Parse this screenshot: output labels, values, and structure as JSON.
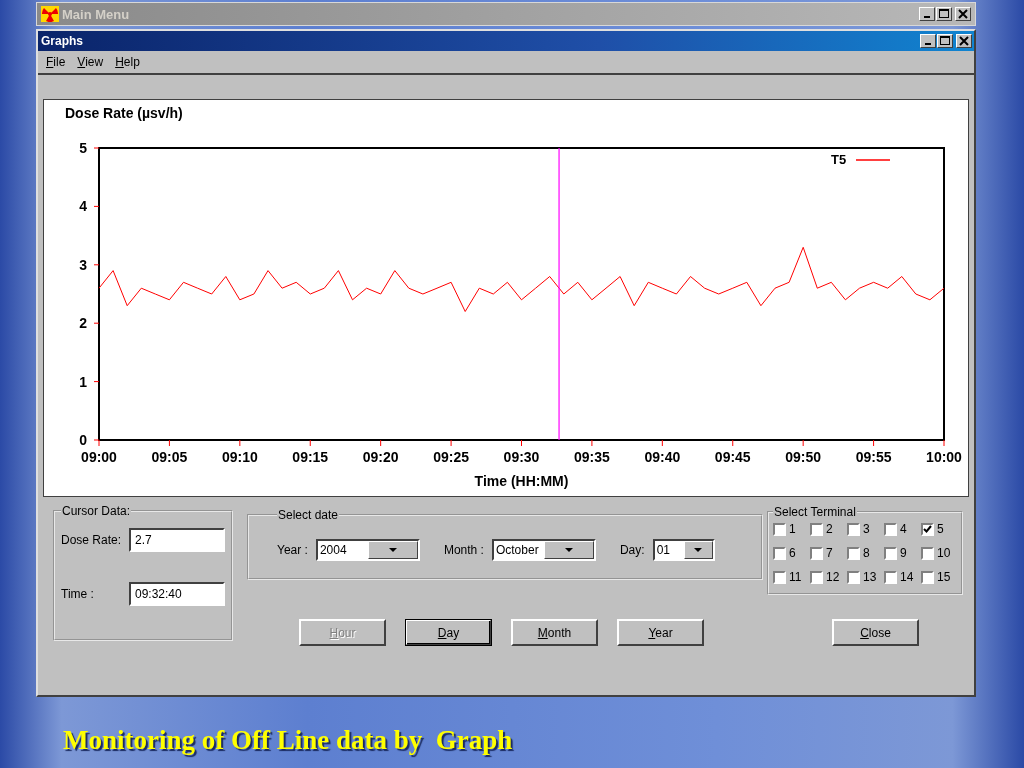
{
  "background_window": {
    "title": "Main Menu"
  },
  "window": {
    "title": "Graphs"
  },
  "menu": [
    "File",
    "View",
    "Help"
  ],
  "chart": {
    "chart_data": {
      "type": "line",
      "title": "Dose Rate (µsv/h)",
      "xlabel": "Time (HH:MM)",
      "ylim": [
        0,
        5
      ],
      "categories": [
        "09:00",
        null,
        null,
        null,
        null,
        "09:05",
        null,
        null,
        null,
        null,
        "09:10",
        null,
        null,
        null,
        null,
        "09:15",
        null,
        null,
        null,
        null,
        "09:20",
        null,
        null,
        null,
        null,
        "09:25",
        null,
        null,
        null,
        null,
        "09:30",
        null,
        null,
        null,
        null,
        "09:35",
        null,
        null,
        null,
        null,
        "09:40",
        null,
        null,
        null,
        null,
        "09:45",
        null,
        null,
        null,
        null,
        "09:50",
        null,
        null,
        null,
        null,
        "09:55",
        null,
        null,
        null,
        null,
        "10:00"
      ],
      "yticks": [
        0,
        1,
        2,
        3,
        4,
        5
      ],
      "series": [
        {
          "name": "T5",
          "color": "#ff0000",
          "values": [
            2.6,
            2.9,
            2.3,
            2.6,
            2.5,
            2.4,
            2.7,
            2.6,
            2.5,
            2.8,
            2.4,
            2.5,
            2.9,
            2.6,
            2.7,
            2.5,
            2.6,
            2.9,
            2.4,
            2.6,
            2.5,
            2.9,
            2.6,
            2.5,
            2.6,
            2.7,
            2.2,
            2.6,
            2.5,
            2.7,
            2.4,
            2.6,
            2.8,
            2.5,
            2.7,
            2.4,
            2.6,
            2.8,
            2.3,
            2.7,
            2.6,
            2.5,
            2.8,
            2.6,
            2.5,
            2.6,
            2.7,
            2.3,
            2.6,
            2.7,
            3.3,
            2.6,
            2.7,
            2.4,
            2.6,
            2.7,
            2.6,
            2.8,
            2.5,
            2.4,
            2.6
          ]
        }
      ]
    }
  },
  "cursor_data": {
    "title": "Cursor Data:",
    "fields": [
      {
        "label": "Dose Rate:",
        "value": "2.7"
      },
      {
        "label": "Time :",
        "value": "09:32:40"
      }
    ]
  },
  "select_date": {
    "title": "Select date",
    "dropdowns": [
      {
        "label": "Year :",
        "value": "2004"
      },
      {
        "label": "Month :",
        "value": "October"
      },
      {
        "label": "Day:",
        "value": "01"
      }
    ]
  },
  "select_terminal": {
    "title": "Select Terminal",
    "terminals": [
      {
        "label": "1",
        "checked": false
      },
      {
        "label": "2",
        "checked": false
      },
      {
        "label": "3",
        "checked": false
      },
      {
        "label": "4",
        "checked": false
      },
      {
        "label": "5",
        "checked": true
      },
      {
        "label": "6",
        "checked": false
      },
      {
        "label": "7",
        "checked": false
      },
      {
        "label": "8",
        "checked": false
      },
      {
        "label": "9",
        "checked": false
      },
      {
        "label": "10",
        "checked": false
      },
      {
        "label": "11",
        "checked": false
      },
      {
        "label": "12",
        "checked": false
      },
      {
        "label": "13",
        "checked": false
      },
      {
        "label": "14",
        "checked": false
      },
      {
        "label": "15",
        "checked": false
      }
    ]
  },
  "buttons": [
    {
      "label": "Hour",
      "disabled": true,
      "default": false
    },
    {
      "label": "Day",
      "disabled": false,
      "default": true
    },
    {
      "label": "Month",
      "disabled": false,
      "default": false
    },
    {
      "label": "Year",
      "disabled": false,
      "default": false
    },
    {
      "label": "Close",
      "disabled": false,
      "default": false
    }
  ],
  "slide_title": "Monitoring of Off Line data by  Graph"
}
